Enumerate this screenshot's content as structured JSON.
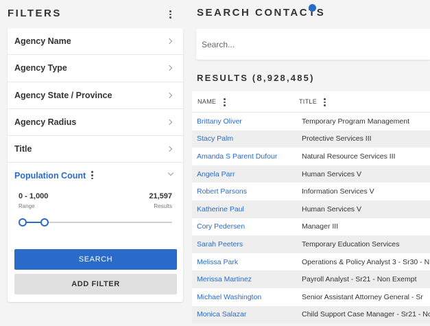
{
  "filters": {
    "title": "FILTERS",
    "items": [
      {
        "label": "Agency Name"
      },
      {
        "label": "Agency Type"
      },
      {
        "label": "Agency State / Province"
      },
      {
        "label": "Agency Radius"
      },
      {
        "label": "Title"
      }
    ],
    "population": {
      "label": "Population Count",
      "range_value": "0 - 1,000",
      "range_caption": "Range",
      "results_value": "21,597",
      "results_caption": "Results",
      "slider_low_fraction": 0.0,
      "slider_high_fraction": 0.15
    },
    "search_button": "SEARCH",
    "add_filter_button": "ADD FILTER"
  },
  "search": {
    "title": "SEARCH CONTACTS",
    "placeholder": "Search..."
  },
  "results": {
    "title": "RESULTS (8,928,485)",
    "columns": {
      "name": "NAME",
      "title": "TITLE"
    },
    "rows": [
      {
        "name": "Brittany Oliver",
        "title": "Temporary Program Management"
      },
      {
        "name": "Stacy Palm",
        "title": "Protective Services III"
      },
      {
        "name": "Amanda S Parent Dufour",
        "title": "Natural Resource Services III"
      },
      {
        "name": "Angela Parr",
        "title": "Human Services V"
      },
      {
        "name": "Robert Parsons",
        "title": "Information Services V"
      },
      {
        "name": "Katherine Paul",
        "title": "Human Services V"
      },
      {
        "name": "Cory Pedersen",
        "title": "Manager III"
      },
      {
        "name": "Sarah Peeters",
        "title": "Temporary Education Services"
      },
      {
        "name": "Melissa Park",
        "title": "Operations & Policy Analyst 3 - Sr30 - N"
      },
      {
        "name": "Merissa Martinez",
        "title": "Payroll Analyst - Sr21 - Non Exempt"
      },
      {
        "name": "Michael Washington",
        "title": "Senior Assistant Attorney General - Sr"
      },
      {
        "name": "Monica Salazar",
        "title": "Child Support Case Manager - Sr21 - No"
      }
    ]
  },
  "colors": {
    "accent": "#2a6ac9",
    "background": "#f4f4f4"
  }
}
